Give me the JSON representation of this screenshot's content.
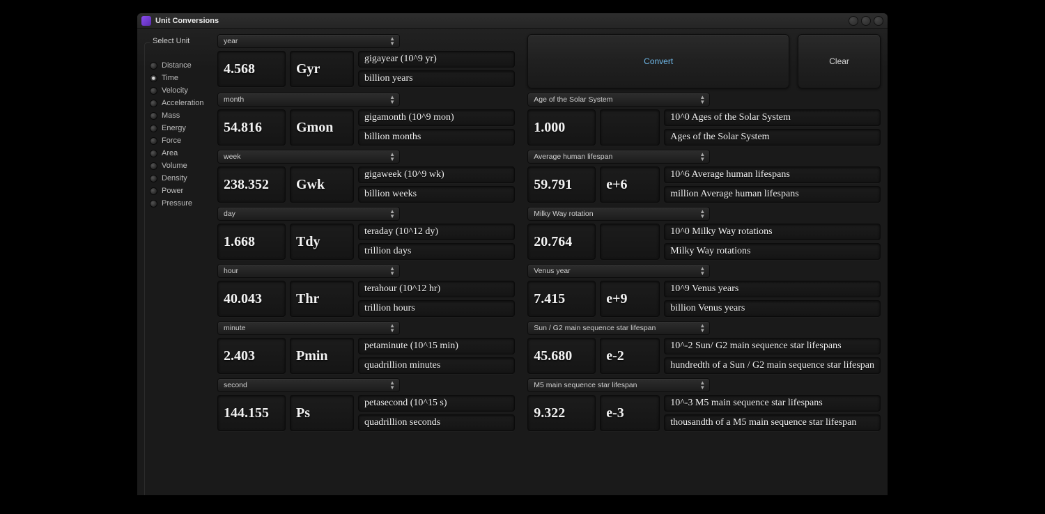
{
  "window": {
    "title": "Unit Conversions"
  },
  "sidebar": {
    "label": "Select Unit",
    "items": [
      {
        "label": "Distance",
        "selected": false
      },
      {
        "label": "Time",
        "selected": true
      },
      {
        "label": "Velocity",
        "selected": false
      },
      {
        "label": "Acceleration",
        "selected": false
      },
      {
        "label": "Mass",
        "selected": false
      },
      {
        "label": "Energy",
        "selected": false
      },
      {
        "label": "Force",
        "selected": false
      },
      {
        "label": "Area",
        "selected": false
      },
      {
        "label": "Volume",
        "selected": false
      },
      {
        "label": "Density",
        "selected": false
      },
      {
        "label": "Power",
        "selected": false
      },
      {
        "label": "Pressure",
        "selected": false
      }
    ]
  },
  "buttons": {
    "convert": "Convert",
    "clear": "Clear"
  },
  "left": [
    {
      "unit": "year",
      "value": "4.568",
      "abbr": "Gyr",
      "desc1": "gigayear  (10^9 yr)",
      "desc2": "billion years"
    },
    {
      "unit": "month",
      "value": "54.816",
      "abbr": "Gmon",
      "desc1": "gigamonth  (10^9 mon)",
      "desc2": "billion months"
    },
    {
      "unit": "week",
      "value": "238.352",
      "abbr": "Gwk",
      "desc1": "gigaweek  (10^9 wk)",
      "desc2": "billion weeks"
    },
    {
      "unit": "day",
      "value": "1.668",
      "abbr": "Tdy",
      "desc1": "teraday  (10^12 dy)",
      "desc2": "trillion days"
    },
    {
      "unit": "hour",
      "value": "40.043",
      "abbr": "Thr",
      "desc1": "terahour  (10^12 hr)",
      "desc2": "trillion hours"
    },
    {
      "unit": "minute",
      "value": "2.403",
      "abbr": "Pmin",
      "desc1": "petaminute  (10^15 min)",
      "desc2": "quadrillion minutes"
    },
    {
      "unit": "second",
      "value": "144.155",
      "abbr": "Ps",
      "desc1": "petasecond  (10^15 s)",
      "desc2": "quadrillion seconds"
    }
  ],
  "right": [
    {
      "unit": "Age of the Solar System",
      "value": "1.000",
      "abbr": "",
      "desc1": "10^0 Ages of the Solar System",
      "desc2": "Ages of the Solar System"
    },
    {
      "unit": "Average human lifespan",
      "value": "59.791",
      "abbr": "e+6",
      "desc1": "10^6 Average human lifespans",
      "desc2": "million Average human lifespans"
    },
    {
      "unit": "Milky Way rotation",
      "value": "20.764",
      "abbr": "",
      "desc1": "10^0 Milky Way rotations",
      "desc2": "Milky Way rotations"
    },
    {
      "unit": "Venus year",
      "value": "7.415",
      "abbr": "e+9",
      "desc1": "10^9 Venus years",
      "desc2": "billion Venus years"
    },
    {
      "unit": "Sun / G2 main sequence star lifespan",
      "value": "45.680",
      "abbr": "e-2",
      "desc1": "10^-2 Sun/ G2 main sequence star lifespans",
      "desc2": "hundredth of a Sun / G2 main sequence star lifespan"
    },
    {
      "unit": "M5 main sequence star lifespan",
      "value": "9.322",
      "abbr": "e-3",
      "desc1": "10^-3 M5 main sequence star lifespans",
      "desc2": "thousandth of a M5 main sequence star lifespan"
    }
  ]
}
